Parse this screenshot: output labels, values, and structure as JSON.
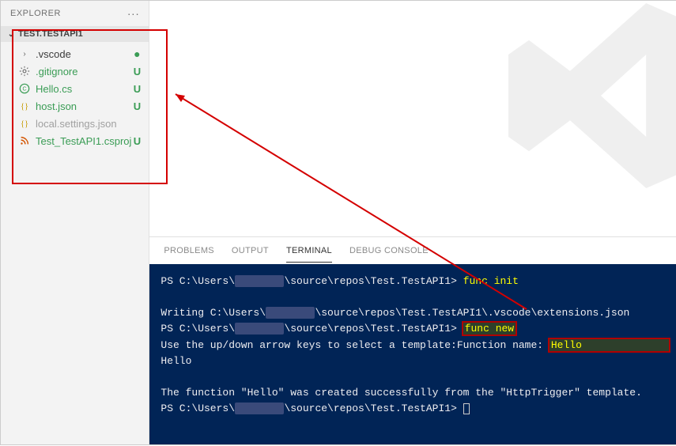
{
  "sidebar": {
    "title": "EXPLORER",
    "folder": "TEST.TESTAPI1",
    "items": [
      {
        "label": ".vscode",
        "status": "",
        "status_class": "dot-green",
        "icon": "chevron",
        "git_mod": true,
        "dim": false
      },
      {
        "label": ".gitignore",
        "status": "U",
        "status_class": "git-u",
        "icon": "gear",
        "git_mod": false,
        "dim": false
      },
      {
        "label": "Hello.cs",
        "status": "U",
        "status_class": "git-u",
        "icon": "csharp",
        "git_mod": false,
        "dim": false
      },
      {
        "label": "host.json",
        "status": "U",
        "status_class": "git-u",
        "icon": "braces",
        "git_mod": false,
        "dim": false
      },
      {
        "label": "local.settings.json",
        "status": "",
        "status_class": "",
        "icon": "braces",
        "git_mod": false,
        "dim": true
      },
      {
        "label": "Test_TestAPI1.csproj",
        "status": "U",
        "status_class": "git-u",
        "icon": "feed",
        "git_mod": false,
        "dim": false
      }
    ]
  },
  "panel": {
    "tabs": [
      "PROBLEMS",
      "OUTPUT",
      "TERMINAL",
      "DEBUG CONSOLE"
    ],
    "active_tab": "TERMINAL"
  },
  "terminal": {
    "line1_prefix": "PS C:\\Users\\",
    "line1_path": "\\source\\repos\\Test.TestAPI1>",
    "line1_cmd": "func init",
    "line2_prefix": "Writing C:\\Users\\",
    "line2_path": "\\source\\repos\\Test.TestAPI1\\.vscode\\extensions.json",
    "line3_prefix": "PS C:\\Users\\",
    "line3_path": "\\source\\repos\\Test.TestAPI1>",
    "line3_cmd": "func new",
    "line4_a": "Use the up/down arrow keys to select a template:Function name: ",
    "line4_b": "Hello",
    "line5": "Hello",
    "line6": "The function \"Hello\" was created successfully from the \"HttpTrigger\" template.",
    "line7_prefix": "PS C:\\Users\\",
    "line7_path": "\\source\\repos\\Test.TestAPI1>"
  }
}
